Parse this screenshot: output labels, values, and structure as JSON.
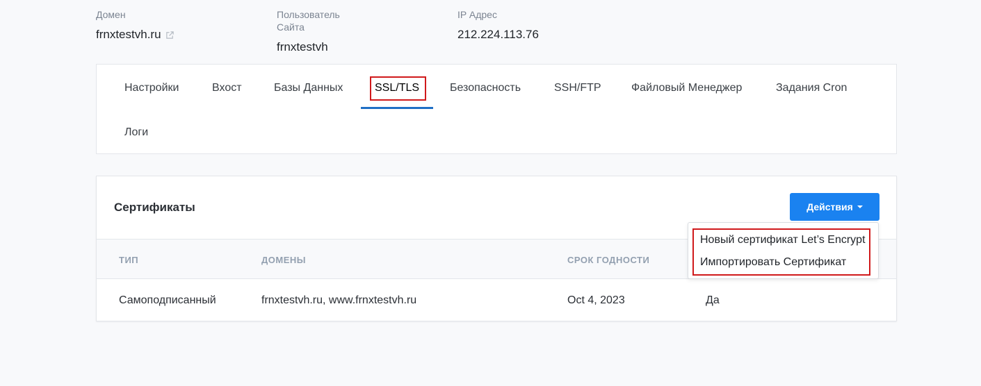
{
  "site_info": {
    "domain": {
      "label": "Домен",
      "value": "frnxtestvh.ru",
      "icon": "external-link-icon"
    },
    "site_user": {
      "label": "Пользователь Сайта",
      "value": "frnxtestvh"
    },
    "ip": {
      "label": "IP Адрес",
      "value": "212.224.113.76"
    }
  },
  "tabs": [
    {
      "label": "Настройки"
    },
    {
      "label": "Вхост"
    },
    {
      "label": "Базы Данных"
    },
    {
      "label": "SSL/TLS",
      "active": true
    },
    {
      "label": "Безопасность"
    },
    {
      "label": "SSH/FTP"
    },
    {
      "label": "Файловый Менеджер"
    },
    {
      "label": "Задания Cron"
    },
    {
      "label": "Логи"
    }
  ],
  "certificates": {
    "title": "Сертификаты",
    "actions_label": "Действия",
    "columns": [
      "ТИП",
      "ДОМЕНЫ",
      "СРОК ГОДНОСТИ"
    ],
    "rows": [
      {
        "type": "Самоподписанный",
        "domains": "frnxtestvh.ru, www.frnxtestvh.ru",
        "expiry": "Oct 4, 2023",
        "extra": "Да"
      }
    ],
    "actions_menu": [
      "Новый сертификат Let’s Encrypt",
      "Импортировать Сертификат"
    ]
  },
  "colors": {
    "accent": "#1a82f0",
    "highlight": "#d0191b",
    "tab_underline": "#1f6fc5"
  }
}
